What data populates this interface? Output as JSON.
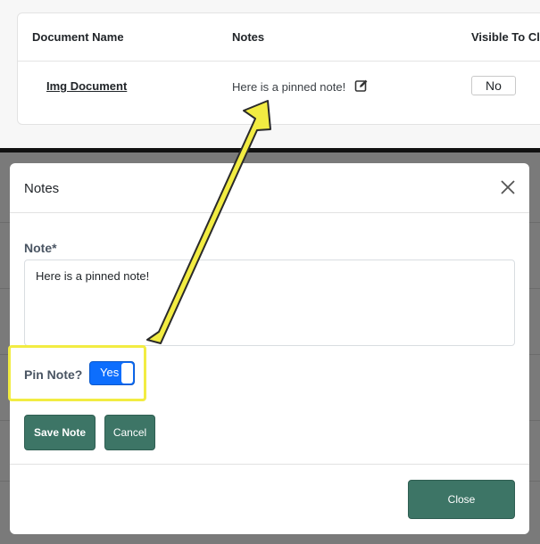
{
  "table": {
    "headers": [
      "Document Name",
      "Notes",
      "Visible To Cli"
    ],
    "row": {
      "document_name": "Img Document",
      "note": "Here is a pinned note!",
      "visible_to_client": "No"
    }
  },
  "modal": {
    "title": "Notes",
    "note_label": "Note*",
    "note_value": "Here is a pinned note!",
    "pin_label": "Pin Note?",
    "pin_toggle": "Yes",
    "save_button": "Save Note",
    "cancel_button": "Cancel",
    "close_button": "Close"
  },
  "icons": {
    "edit": "edit-icon",
    "close": "close-icon"
  },
  "colors": {
    "primary_button": "#3d7566",
    "toggle_on": "#0d6efd",
    "annotation": "#f2ec42"
  }
}
